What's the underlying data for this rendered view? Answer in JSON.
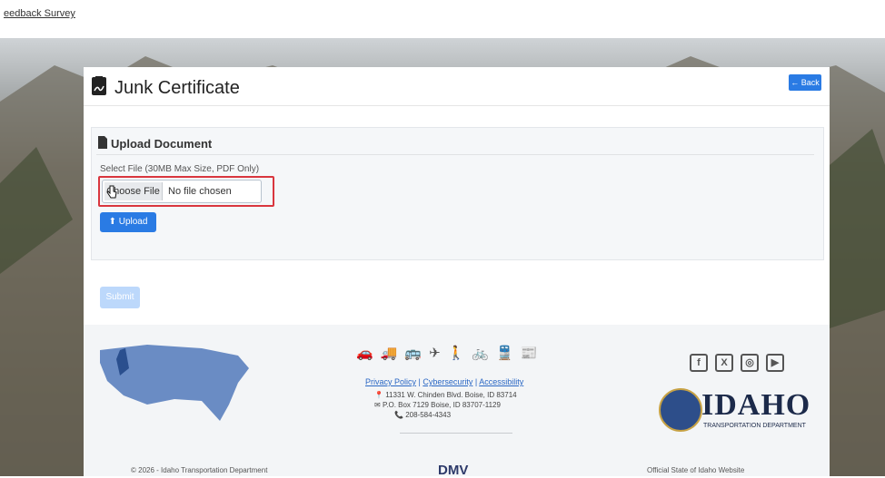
{
  "topbar": {
    "feedback_link": "eedback Survey"
  },
  "page": {
    "title": "Junk Certificate",
    "back_label": "← Back"
  },
  "upload_panel": {
    "title": "Upload Document",
    "file_label": "Select File (30MB Max Size, PDF Only)",
    "choose_file_label": "Choose File",
    "file_status": "No file chosen",
    "upload_label": "Upload",
    "upload_icon": "upload-icon"
  },
  "submit_label": "Submit",
  "footer": {
    "transport_icons": [
      "car-icon",
      "truck-icon",
      "bus-icon",
      "plane-icon",
      "walk-icon",
      "bike-icon",
      "train-icon",
      "newspaper-icon"
    ],
    "links": {
      "privacy": "Privacy Policy",
      "cyber": "Cybersecurity",
      "access": "Accessibility"
    },
    "address1": "11331 W. Chinden Blvd. Boise, ID 83714",
    "address2": "P.O. Box 7129 Boise, ID 83707-1129",
    "phone": "208-584-4343",
    "idaho": "IDAHO",
    "itd": "TRANSPORTATION DEPARTMENT",
    "copyright": "© 2026 - Idaho Transportation Department",
    "dmv": "DMV",
    "official": "Official State of Idaho Website"
  },
  "colors": {
    "primary": "#2a7be4",
    "highlight": "#d9363e"
  }
}
